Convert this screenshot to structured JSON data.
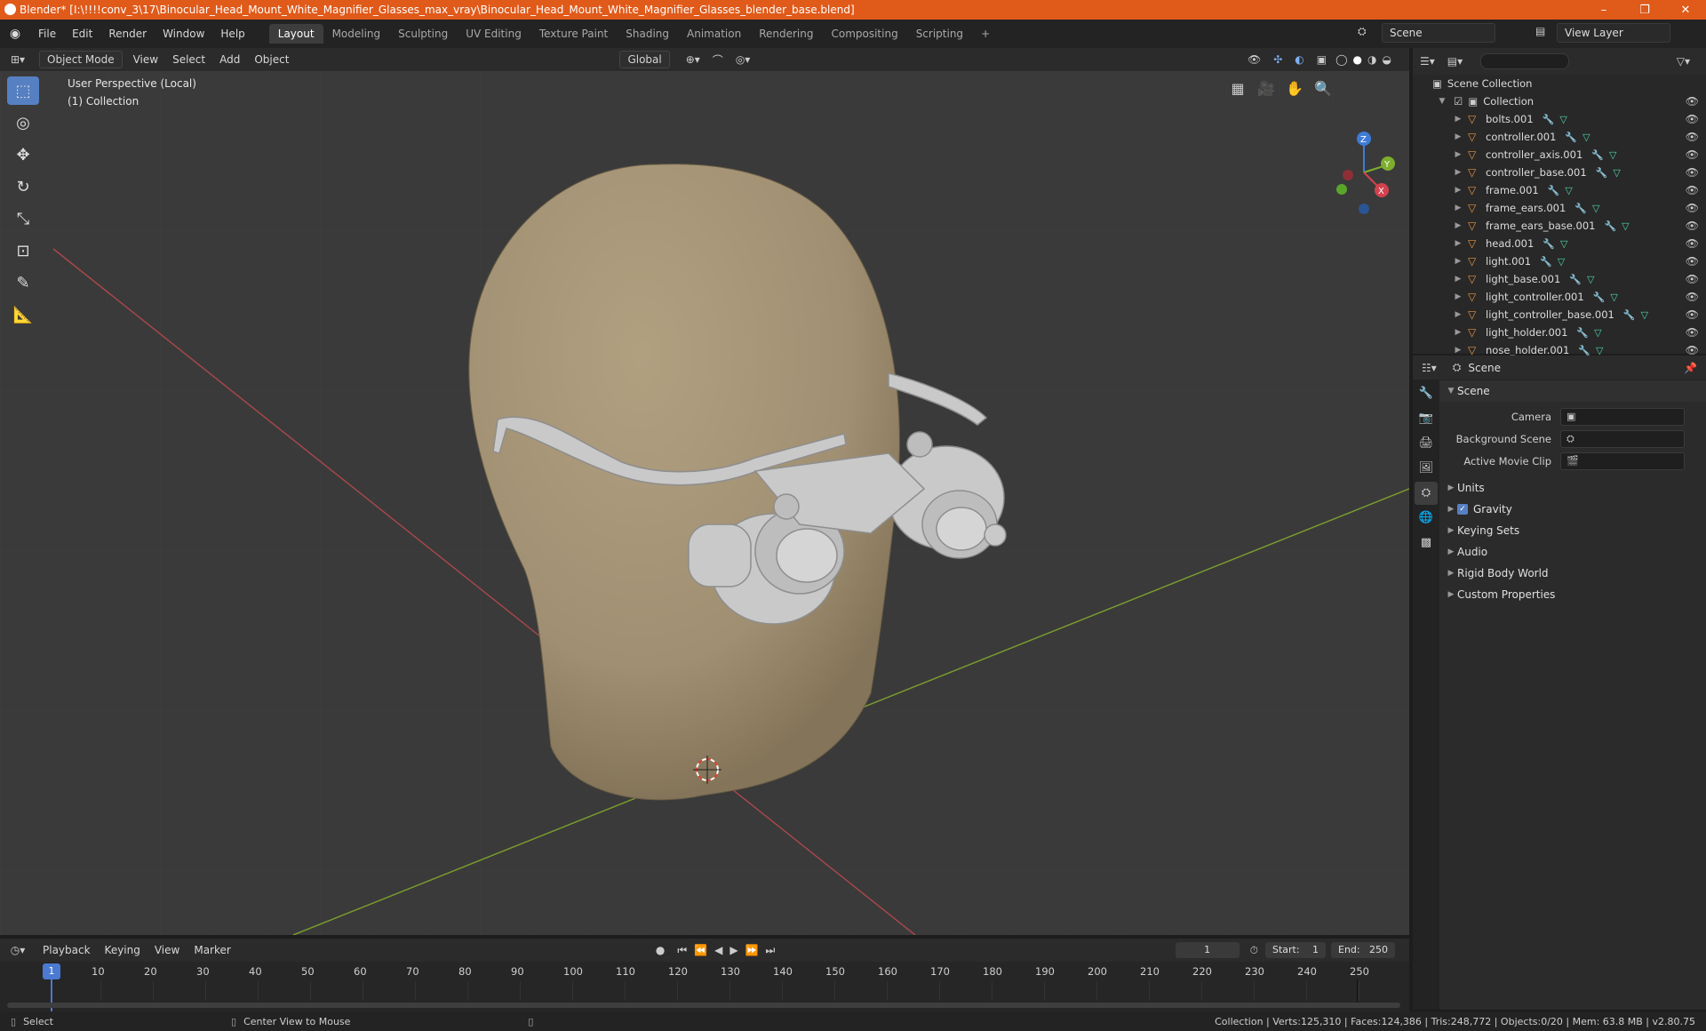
{
  "window": {
    "title": "Blender* [I:\\!!!!conv_3\\17\\Binocular_Head_Mount_White_Magnifier_Glasses_max_vray\\Binocular_Head_Mount_White_Magnifier_Glasses_blender_base.blend]",
    "minimize": "–",
    "restore": "❐",
    "close": "✕"
  },
  "menu": [
    "File",
    "Edit",
    "Render",
    "Window",
    "Help"
  ],
  "workspaces": [
    "Layout",
    "Modeling",
    "Sculpting",
    "UV Editing",
    "Texture Paint",
    "Shading",
    "Animation",
    "Rendering",
    "Compositing",
    "Scripting"
  ],
  "add_workspace": "+",
  "scene_name": "Scene",
  "view_layer": "View Layer",
  "viewport": {
    "mode": "Object Mode",
    "menus": [
      "View",
      "Select",
      "Add",
      "Object"
    ],
    "orientation": "Global",
    "perspective": "User Perspective (Local)",
    "collection": "(1) Collection"
  },
  "gizmo": {
    "z": "Z",
    "y": "Y",
    "x": "X"
  },
  "outliner": {
    "root": "Scene Collection",
    "collection": "Collection",
    "items": [
      "bolts.001",
      "controller.001",
      "controller_axis.001",
      "controller_base.001",
      "frame.001",
      "frame_ears.001",
      "frame_ears_base.001",
      "head.001",
      "light.001",
      "light_base.001",
      "light_controller.001",
      "light_controller_base.001",
      "light_holder.001",
      "nose_holder.001"
    ]
  },
  "properties": {
    "header": "Scene",
    "section": "Scene",
    "camera_label": "Camera",
    "bg_label": "Background Scene",
    "clip_label": "Active Movie Clip",
    "sections": [
      "Units",
      "Gravity",
      "Keying Sets",
      "Audio",
      "Rigid Body World",
      "Custom Properties"
    ]
  },
  "timeline": {
    "menus": [
      "Playback",
      "Keying",
      "View",
      "Marker"
    ],
    "current": "1",
    "start_label": "Start:",
    "start": "1",
    "end_label": "End:",
    "end": "250",
    "ticks": [
      "10",
      "20",
      "30",
      "40",
      "50",
      "60",
      "70",
      "80",
      "90",
      "100",
      "110",
      "120",
      "130",
      "140",
      "150",
      "160",
      "170",
      "180",
      "190",
      "200",
      "210",
      "220",
      "230",
      "240",
      "250"
    ]
  },
  "status": {
    "left": "Select",
    "middle": "Center View to Mouse",
    "right": "Collection | Verts:125,310 | Faces:124,386 | Tris:248,772 | Objects:0/20 | Mem: 63.8 MB | v2.80.75"
  }
}
